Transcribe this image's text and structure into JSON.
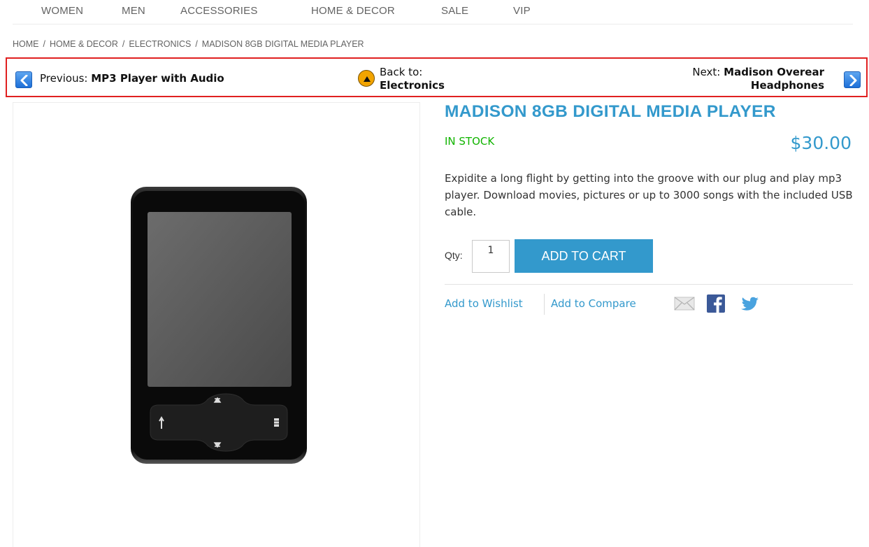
{
  "nav": {
    "items": [
      {
        "label": "WOMEN"
      },
      {
        "label": "MEN"
      },
      {
        "label": "ACCESSORIES"
      },
      {
        "label": "HOME & DECOR"
      },
      {
        "label": "SALE"
      },
      {
        "label": "VIP"
      }
    ]
  },
  "breadcrumb": {
    "items": [
      "HOME",
      "HOME & DECOR",
      "ELECTRONICS",
      "MADISON 8GB DIGITAL MEDIA PLAYER"
    ],
    "separator": "/"
  },
  "prev_next": {
    "previous_label": "Previous:",
    "previous_name": "MP3 Player with Audio",
    "back_label": "Back to:",
    "back_name": "Electronics",
    "next_label": "Next:",
    "next_name_line1": "Madison Overear",
    "next_name_line2": "Headphones"
  },
  "product": {
    "title": "MADISON 8GB DIGITAL MEDIA PLAYER",
    "stock": "IN STOCK",
    "price": "$30.00",
    "description": "Expidite a long flight by getting into the groove with our plug and play mp3 player. Download movies, pictures or up to 3000 songs with the included USB cable.",
    "qty_label": "Qty:",
    "qty_value": "1",
    "add_to_cart": "ADD TO CART",
    "wishlist": "Add to Wishlist",
    "compare": "Add to Compare"
  },
  "colors": {
    "accent": "#3399cc",
    "stock": "#11b400",
    "highlight_border": "#e02020"
  },
  "icons": [
    "chevron-left-icon",
    "up-arrow-icon",
    "chevron-right-icon",
    "mail-icon",
    "facebook-icon",
    "twitter-icon"
  ]
}
